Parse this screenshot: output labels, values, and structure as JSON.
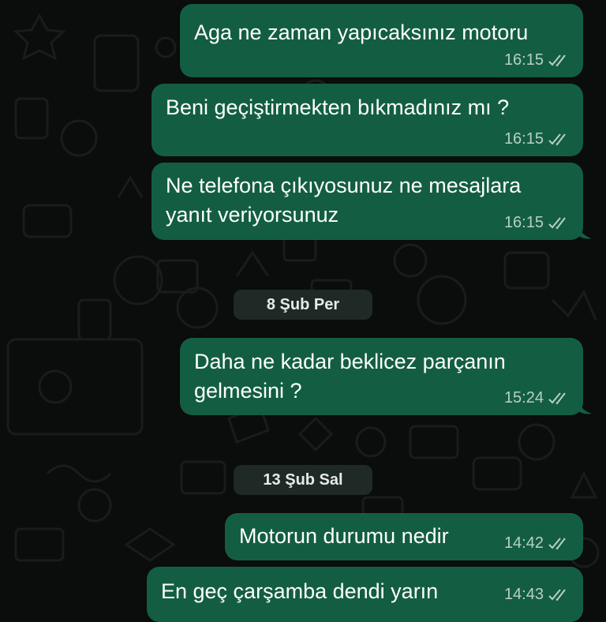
{
  "messages": [
    {
      "lines": [
        "Aga ne zaman yapıcaksınız motoru"
      ],
      "time": "16:15"
    },
    {
      "lines": [
        "Beni geçiştirmekten bıkmadınız mı ?"
      ],
      "time": "16:15"
    },
    {
      "lines": [
        "Ne telefona çıkıyosunuz ne mesajlara",
        "yanıt veriyorsunuz"
      ],
      "time": "16:15"
    },
    {
      "lines": [
        "Daha ne kadar beklicez parçanın",
        "gelmesini ?"
      ],
      "time": "15:24"
    },
    {
      "lines": [
        "Motorun durumu nedir"
      ],
      "time": "14:42"
    },
    {
      "lines": [
        "En geç çarşamba dendi yarın"
      ],
      "time": "14:43"
    }
  ],
  "dates": [
    "8 Şub Per",
    "13 Şub Sal"
  ],
  "read_status_icon": "double-check-icon",
  "colors": {
    "bubble": "#135e43",
    "background": "#0b0c0c",
    "meta_text": "#b9cfc4",
    "date_pill": "#1f2a27"
  }
}
